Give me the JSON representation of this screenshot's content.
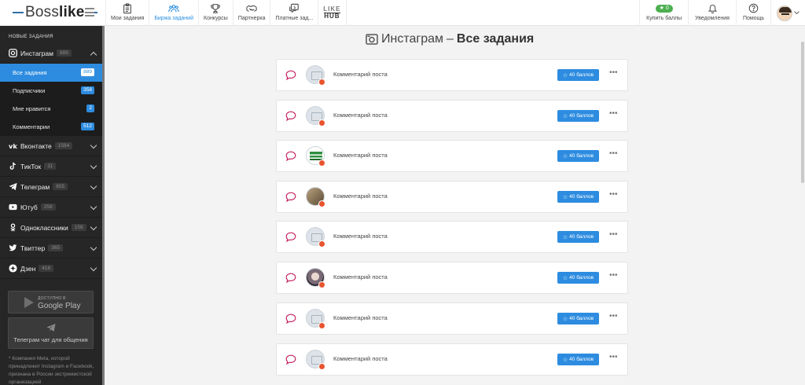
{
  "header": {
    "logo_text": "Boss",
    "logo_bold": "like",
    "nav": [
      {
        "label": "Мои задания",
        "icon": "clipboard-icon",
        "active": false
      },
      {
        "label": "Биржа заданий",
        "icon": "users-icon",
        "active": true
      },
      {
        "label": "Конкурсы",
        "icon": "trophy-icon",
        "active": false
      },
      {
        "label": "Партнерка",
        "icon": "handshake-icon",
        "active": false
      },
      {
        "label": "Платные зад...",
        "icon": "dollar-chat-icon",
        "active": false
      }
    ],
    "hub_line1": "LIKE",
    "hub_line2": "HUB",
    "buy_points_count": "0",
    "buy_points_label": "Купить баллы",
    "notifications_label": "Уведомления",
    "help_label": "Помощь"
  },
  "sidebar": {
    "heading": "НОВЫЕ ЗАДАНИЯ",
    "instagram": {
      "label": "Инстаграм",
      "count": "889"
    },
    "sub": [
      {
        "label": "Все задания",
        "count": "889"
      },
      {
        "label": "Подписчики",
        "count": "358"
      },
      {
        "label": "Мне нравится",
        "count": "2"
      },
      {
        "label": "Комментарии",
        "count": "512"
      }
    ],
    "networks": [
      {
        "label": "Вконтакте",
        "count": "1584",
        "icon": "vk-icon"
      },
      {
        "label": "ТикТок",
        "count": "11",
        "icon": "tiktok-icon"
      },
      {
        "label": "Телеграм",
        "count": "655",
        "icon": "telegram-icon"
      },
      {
        "label": "Ютуб",
        "count": "258",
        "icon": "youtube-icon"
      },
      {
        "label": "Одноклассники",
        "count": "158",
        "icon": "ok-icon"
      },
      {
        "label": "Твиттер",
        "count": "365",
        "icon": "twitter-icon"
      },
      {
        "label": "Дзен",
        "count": "416",
        "icon": "dzen-icon"
      }
    ],
    "gplay_small": "ДОСТУПНО В",
    "gplay_big": "Google Play",
    "telegram_chat": "Телеграм чат для общения",
    "disclaimer": "* Компания Meta, которой принадлежит Instagram и Facebook, признана в России экстремистской организацией"
  },
  "main": {
    "title_network": "Инстаграм",
    "title_sep": "–",
    "title_bold": "Все задания",
    "tasks": [
      {
        "title": "Комментарий поста",
        "reward": "40 баллов",
        "thumb": "placeholder"
      },
      {
        "title": "Комментарий поста",
        "reward": "40 баллов",
        "thumb": "placeholder"
      },
      {
        "title": "Комментарий поста",
        "reward": "40 баллов",
        "thumb": "img-green"
      },
      {
        "title": "Комментарий поста",
        "reward": "40 баллов",
        "thumb": "img-photo"
      },
      {
        "title": "Комментарий поста",
        "reward": "40 баллов",
        "thumb": "placeholder"
      },
      {
        "title": "Комментарий поста",
        "reward": "40 баллов",
        "thumb": "img-face"
      },
      {
        "title": "Комментарий поста",
        "reward": "40 баллов",
        "thumb": "placeholder"
      },
      {
        "title": "Комментарий поста",
        "reward": "40 баллов",
        "thumb": "placeholder"
      }
    ],
    "more_label": "•••"
  },
  "colors": {
    "accent": "#2d8ce0",
    "sidebar_bg": "#262626",
    "comment_icon": "#c2185b",
    "coins_green": "#4caf50",
    "instagram_dot": "#e8542f"
  }
}
